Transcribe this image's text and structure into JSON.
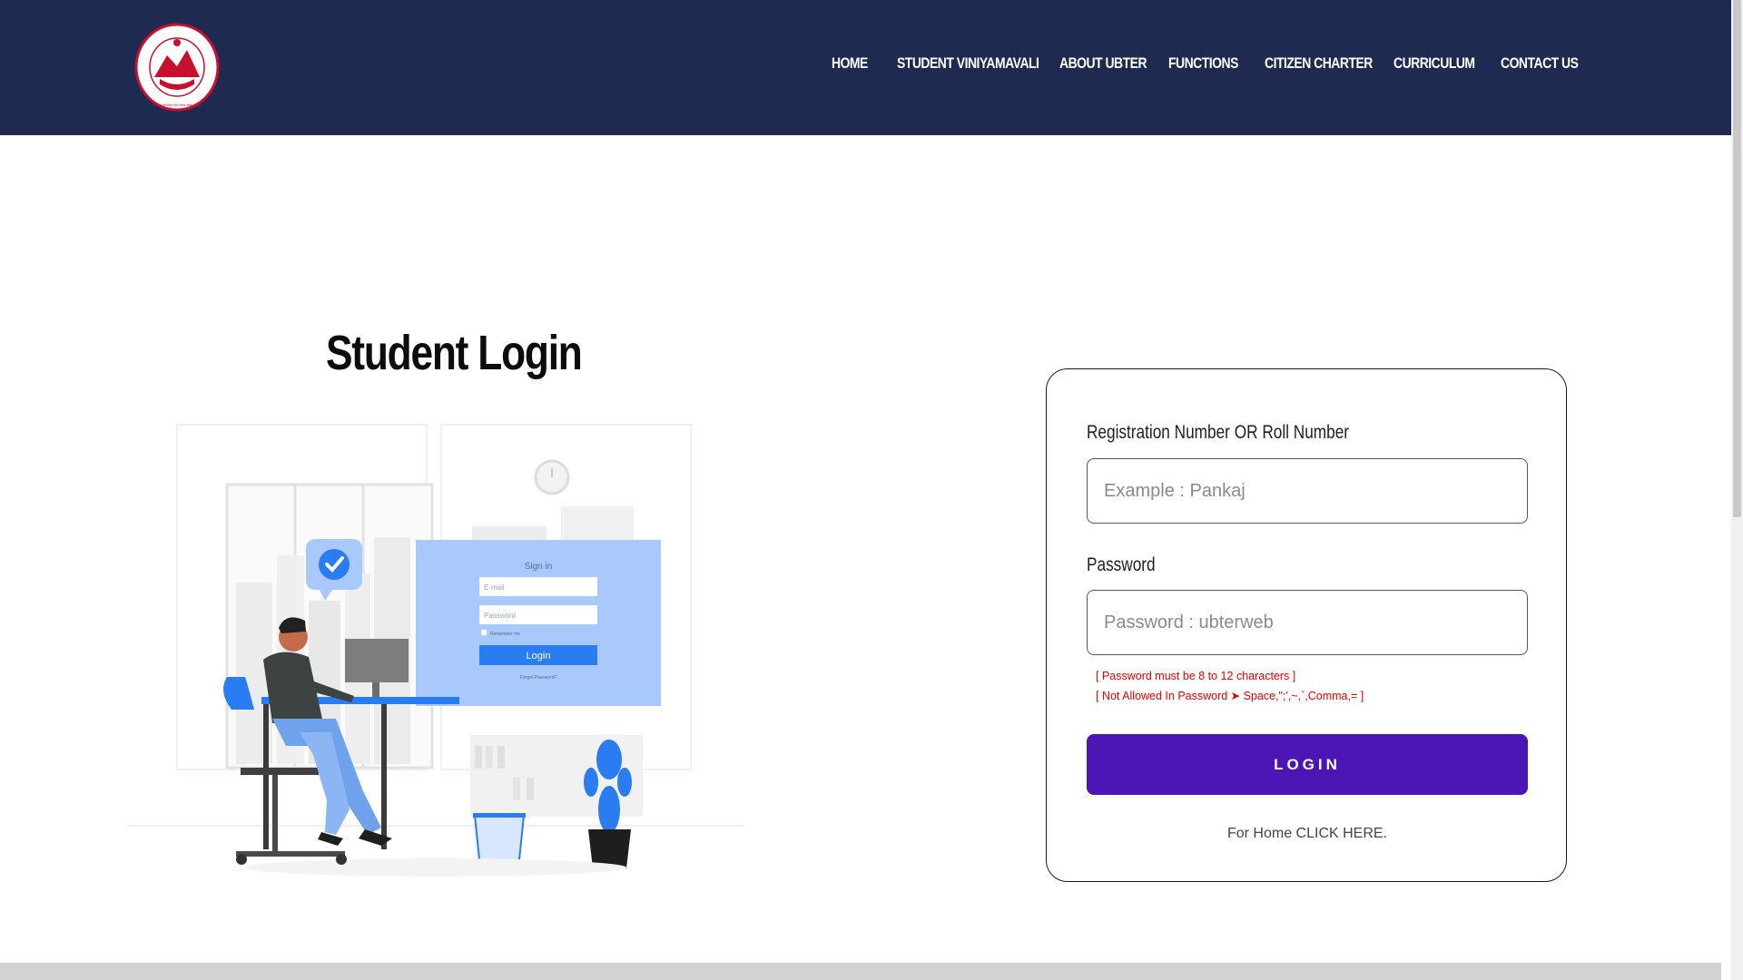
{
  "header": {
    "nav": [
      {
        "label": "HOME"
      },
      {
        "label": "STUDENT VINIYAMAVALI"
      },
      {
        "label": "ABOUT UBTER"
      },
      {
        "label": "FUNCTIONS"
      },
      {
        "label": "CITIZEN CHARTER"
      },
      {
        "label": "CURRICULUM"
      },
      {
        "label": "CONTACT US"
      }
    ],
    "logo": {
      "icon": "ubter-seal-logo",
      "inner_text": "उत्तराखण्ड प्राविधिक शिक्षा परिषद रुड़की (हरिद्वार)"
    }
  },
  "page": {
    "title": "Student Login"
  },
  "illustration": {
    "icon": "person-at-desk-login-illustration",
    "screen_title": "Sign in",
    "email_placeholder": "E-mail",
    "password_placeholder": "Password",
    "remember": "Remember me",
    "button": "Login",
    "forgot": "Forgot Password?"
  },
  "form": {
    "reg_label": "Registration Number OR Roll Number",
    "reg_placeholder": "Example : Pankaj",
    "password_label": "Password",
    "password_placeholder": "Password : ubterweb",
    "note_1": "[ Password must be 8 to 12 characters ]",
    "note_2": "[ Not Allowed In Password ➤ Space,\";',~,`,Comma,= ]",
    "login_label": "LOGIN",
    "home_link": "For Home CLICK HERE."
  },
  "colors": {
    "header_bg": "#1e2a4f",
    "button_bg": "#4b16b5",
    "note": "#e00000",
    "illustration_accent": "#2a7df0"
  }
}
